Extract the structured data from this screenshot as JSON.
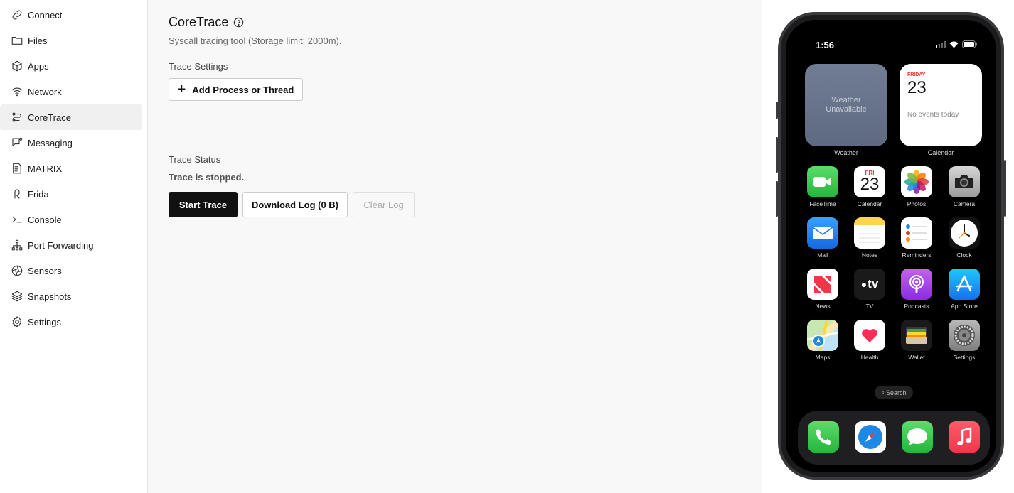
{
  "sidebar": {
    "items": [
      {
        "label": "Connect",
        "icon": "link-icon"
      },
      {
        "label": "Files",
        "icon": "folder-icon"
      },
      {
        "label": "Apps",
        "icon": "cube-icon"
      },
      {
        "label": "Network",
        "icon": "wifi-icon"
      },
      {
        "label": "CoreTrace",
        "icon": "trace-icon",
        "active": true
      },
      {
        "label": "Messaging",
        "icon": "message-icon"
      },
      {
        "label": "MATRIX",
        "icon": "document-icon"
      },
      {
        "label": "Frida",
        "icon": "frida-icon"
      },
      {
        "label": "Console",
        "icon": "terminal-icon"
      },
      {
        "label": "Port Forwarding",
        "icon": "network-tree-icon"
      },
      {
        "label": "Sensors",
        "icon": "aperture-icon"
      },
      {
        "label": "Snapshots",
        "icon": "layers-icon"
      },
      {
        "label": "Settings",
        "icon": "gear-icon"
      }
    ]
  },
  "main": {
    "title": "CoreTrace",
    "subtitle": "Syscall tracing tool (Storage limit: 2000m).",
    "trace_settings_label": "Trace Settings",
    "add_process_label": "Add Process or Thread",
    "trace_status_label": "Trace Status",
    "status_text": "Trace is stopped.",
    "start_label": "Start Trace",
    "download_label": "Download Log (0 B)",
    "clear_label": "Clear Log"
  },
  "device": {
    "time": "1:56",
    "weather_widget": {
      "text": "Weather Unavailable",
      "label": "Weather"
    },
    "calendar_widget": {
      "day": "FRIDAY",
      "date": "23",
      "events": "No events today",
      "label": "Calendar"
    },
    "apps": [
      {
        "name": "FaceTime",
        "icon": "facetime-icon"
      },
      {
        "name": "Calendar",
        "icon": "calendar-icon",
        "day": "FRI",
        "date": "23"
      },
      {
        "name": "Photos",
        "icon": "photos-icon"
      },
      {
        "name": "Camera",
        "icon": "camera-icon"
      },
      {
        "name": "Mail",
        "icon": "mail-icon"
      },
      {
        "name": "Notes",
        "icon": "notes-icon"
      },
      {
        "name": "Reminders",
        "icon": "reminders-icon"
      },
      {
        "name": "Clock",
        "icon": "clock-icon"
      },
      {
        "name": "News",
        "icon": "news-icon"
      },
      {
        "name": "TV",
        "icon": "tv-icon",
        "glyph": "tv"
      },
      {
        "name": "Podcasts",
        "icon": "podcasts-icon"
      },
      {
        "name": "App Store",
        "icon": "app-store-icon"
      },
      {
        "name": "Maps",
        "icon": "maps-icon"
      },
      {
        "name": "Health",
        "icon": "health-icon"
      },
      {
        "name": "Wallet",
        "icon": "wallet-icon"
      },
      {
        "name": "Settings",
        "icon": "settings-icon"
      }
    ],
    "search_label": "Search",
    "dock": [
      {
        "icon": "phone-icon"
      },
      {
        "icon": "safari-icon"
      },
      {
        "icon": "messages-icon"
      },
      {
        "icon": "music-icon"
      }
    ]
  }
}
